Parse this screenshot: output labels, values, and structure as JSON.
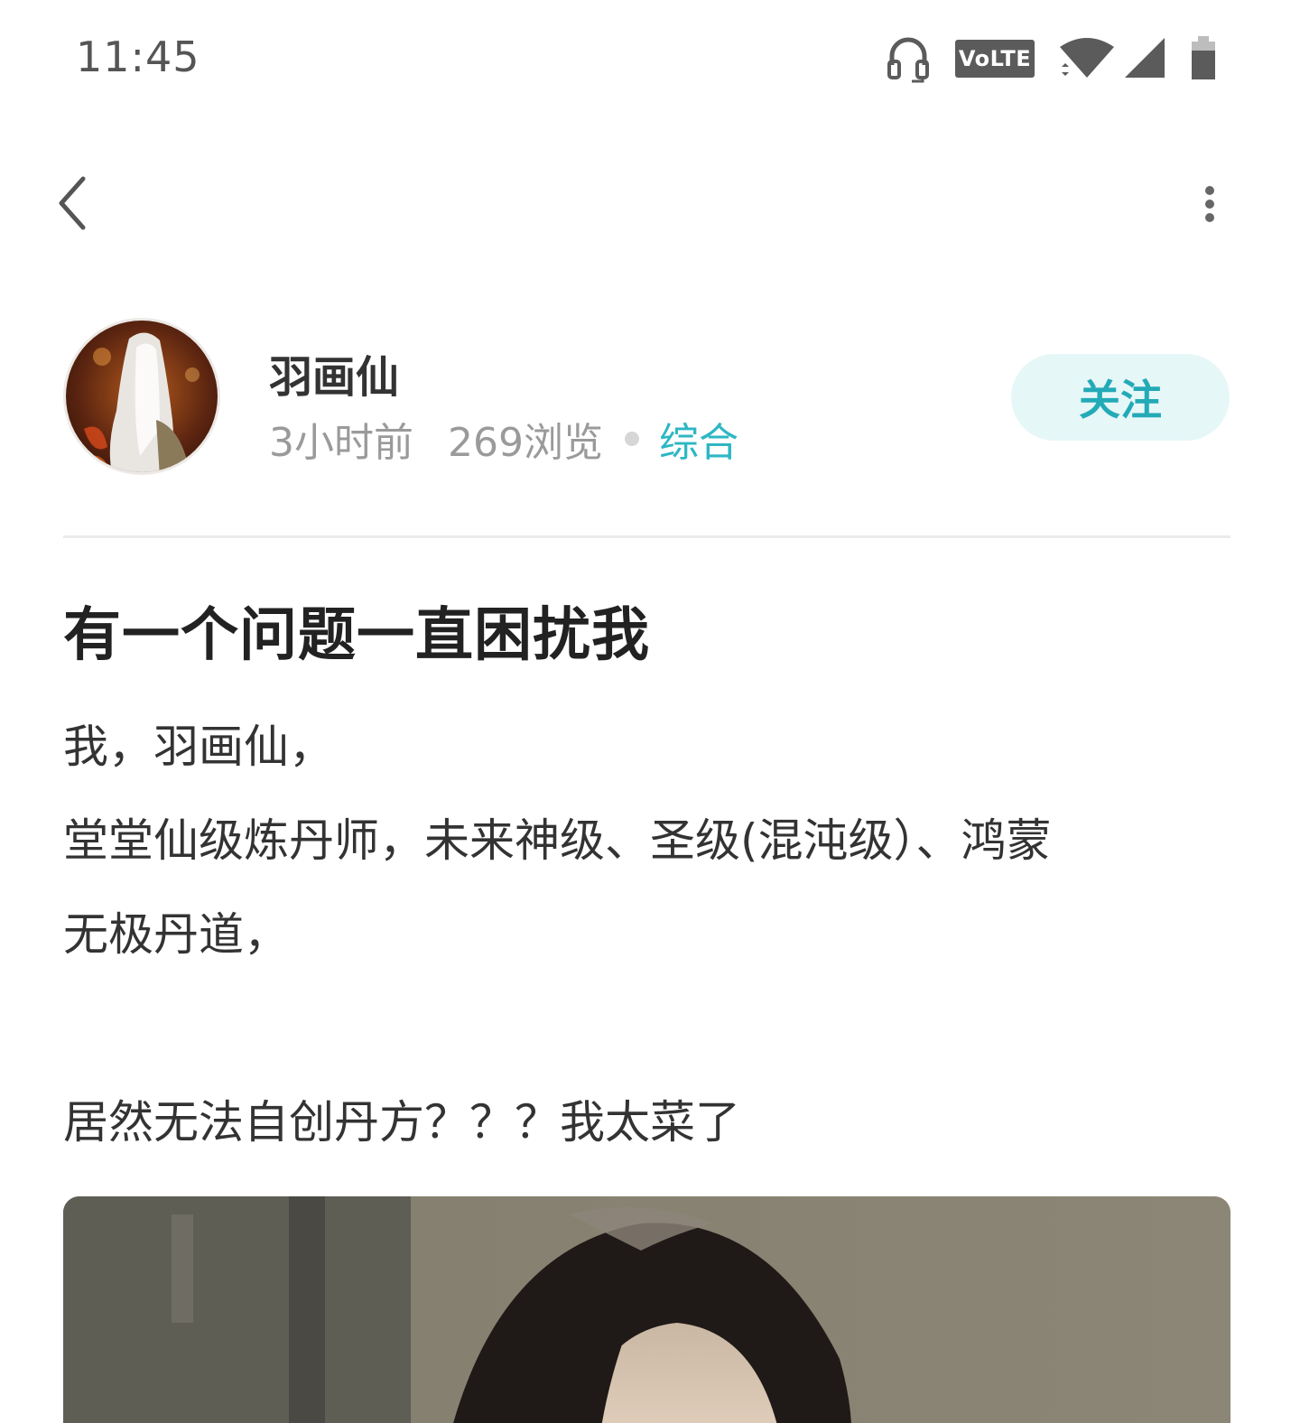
{
  "status_bar": {
    "time": "11:45",
    "volte": "VoLTE",
    "icons": [
      "headset-icon",
      "volte-badge",
      "wifi-icon",
      "cellular-signal-icon",
      "battery-icon"
    ]
  },
  "nav": {
    "back_icon": "chevron-left-icon",
    "more_icon": "more-vertical-icon"
  },
  "author": {
    "name": "羽画仙",
    "time_ago": "3小时前",
    "views": "269浏览",
    "category": "综合",
    "follow_label": "关注"
  },
  "post": {
    "title": "有一个问题一直困扰我",
    "lines": [
      "我，羽画仙，",
      "堂堂仙级炼丹师，未来神级、圣级(混沌级）、鸿蒙",
      "无极丹道，",
      "居然无法自创丹方？？？我太菜了"
    ]
  },
  "colors": {
    "accent": "#2db7c3",
    "follow_bg": "#e6f7f8",
    "text": "#333333",
    "meta": "#9a9a9a"
  }
}
